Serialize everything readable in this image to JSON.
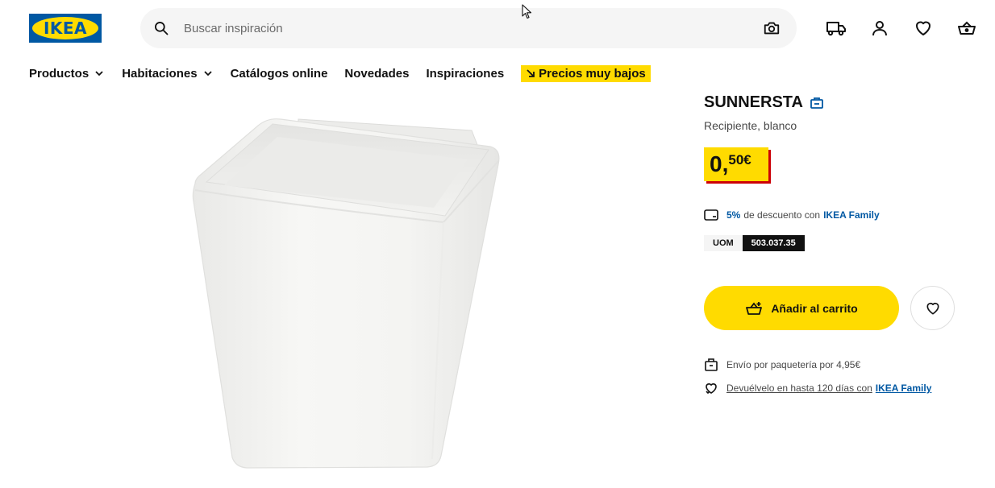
{
  "header": {
    "logo_text": "IKEA",
    "search_placeholder": "Buscar inspiración",
    "icons": [
      "delivery-truck-icon",
      "user-icon",
      "heart-icon",
      "shopping-basket-icon"
    ]
  },
  "nav": {
    "items": [
      {
        "label": "Productos",
        "has_dropdown": true
      },
      {
        "label": "Habitaciones",
        "has_dropdown": true
      },
      {
        "label": "Catálogos online",
        "has_dropdown": false
      },
      {
        "label": "Novedades",
        "has_dropdown": false
      },
      {
        "label": "Inspiraciones",
        "has_dropdown": false
      }
    ],
    "promo_label": "Precios muy bajos"
  },
  "product": {
    "name": "SUNNERSTA",
    "description": "Recipiente, blanco",
    "price_integer": "0,",
    "price_decimal": "50€",
    "family_discount_percent": "5%",
    "family_discount_text": "de descuento con",
    "family_name": "IKEA Family",
    "article_label": "UOM",
    "article_number": "503.037.35",
    "add_to_cart_label": "Añadir al carrito",
    "shipping_text": "Envío por paquetería por 4,95€",
    "return_text": "Devuélvelo en hasta 120 días con",
    "return_family": "IKEA Family"
  },
  "colors": {
    "ikea_blue": "#0058a3",
    "ikea_yellow": "#ffdb00",
    "price_shadow_red": "#cc0008"
  }
}
